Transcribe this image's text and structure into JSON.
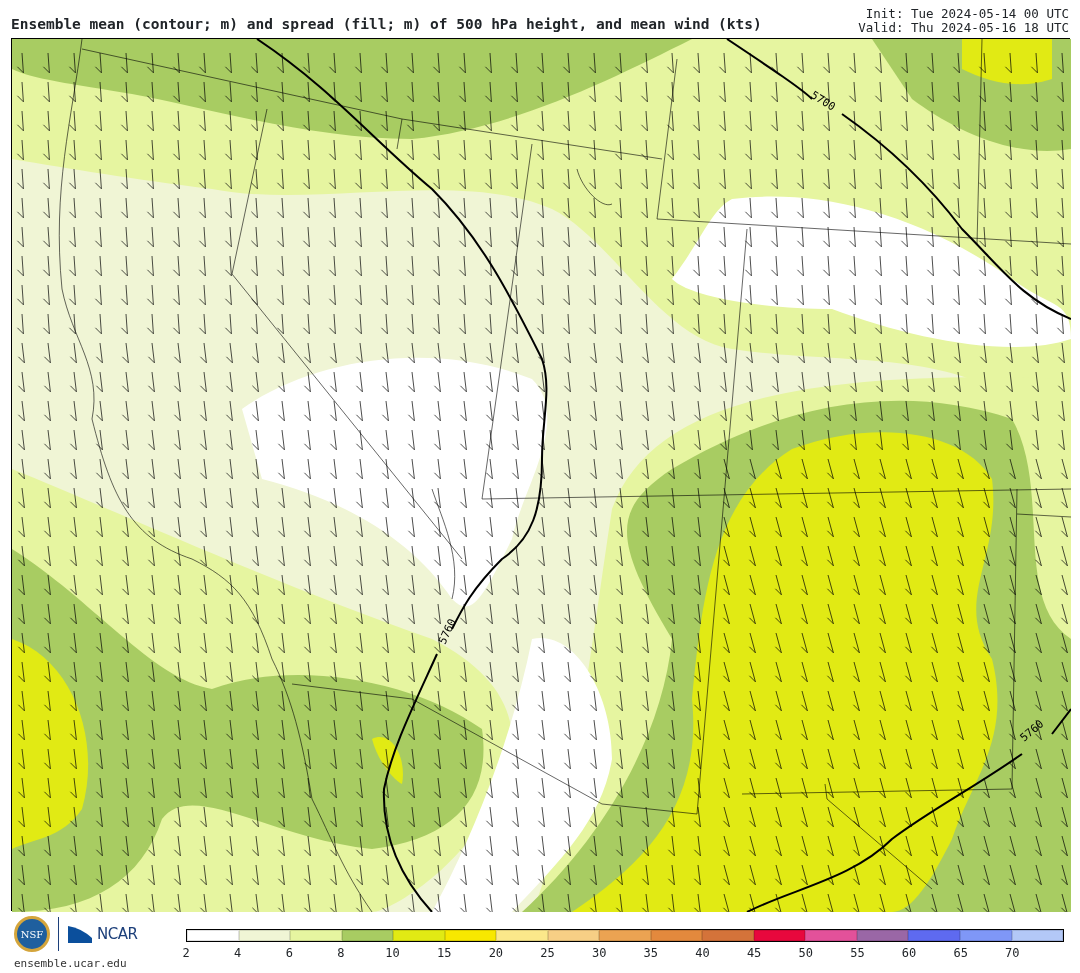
{
  "title": "Ensemble mean (contour; m) and spread (fill; m) of 500 hPa height, and mean wind (kts)",
  "init": "Init: Tue 2024-05-14 00 UTC",
  "valid": "Valid: Thu 2024-05-16 18 UTC",
  "contour_labels": [
    "5700",
    "5760",
    "5760"
  ],
  "logos": {
    "nsf": "NSF",
    "ncar": "NCAR",
    "site": "ensemble.ucar.edu"
  },
  "colorbar": {
    "bins": [
      {
        "color": "#ffffff"
      },
      {
        "color": "#f0f5d5"
      },
      {
        "color": "#e6f5a0"
      },
      {
        "color": "#a8cc62"
      },
      {
        "color": "#e1ea14"
      },
      {
        "color": "#f8e800"
      },
      {
        "color": "#fbe88a"
      },
      {
        "color": "#f7cf85"
      },
      {
        "color": "#eba352"
      },
      {
        "color": "#e3893d"
      },
      {
        "color": "#d4733a"
      },
      {
        "color": "#e8083d"
      },
      {
        "color": "#e3519a"
      },
      {
        "color": "#9a67a6"
      },
      {
        "color": "#5e6af0"
      },
      {
        "color": "#7f97f7"
      },
      {
        "color": "#b3c8f7"
      }
    ],
    "ticks": [
      "2",
      "4",
      "6",
      "8",
      "10",
      "15",
      "20",
      "25",
      "30",
      "35",
      "40",
      "45",
      "50",
      "55",
      "60",
      "65",
      "70"
    ]
  }
}
